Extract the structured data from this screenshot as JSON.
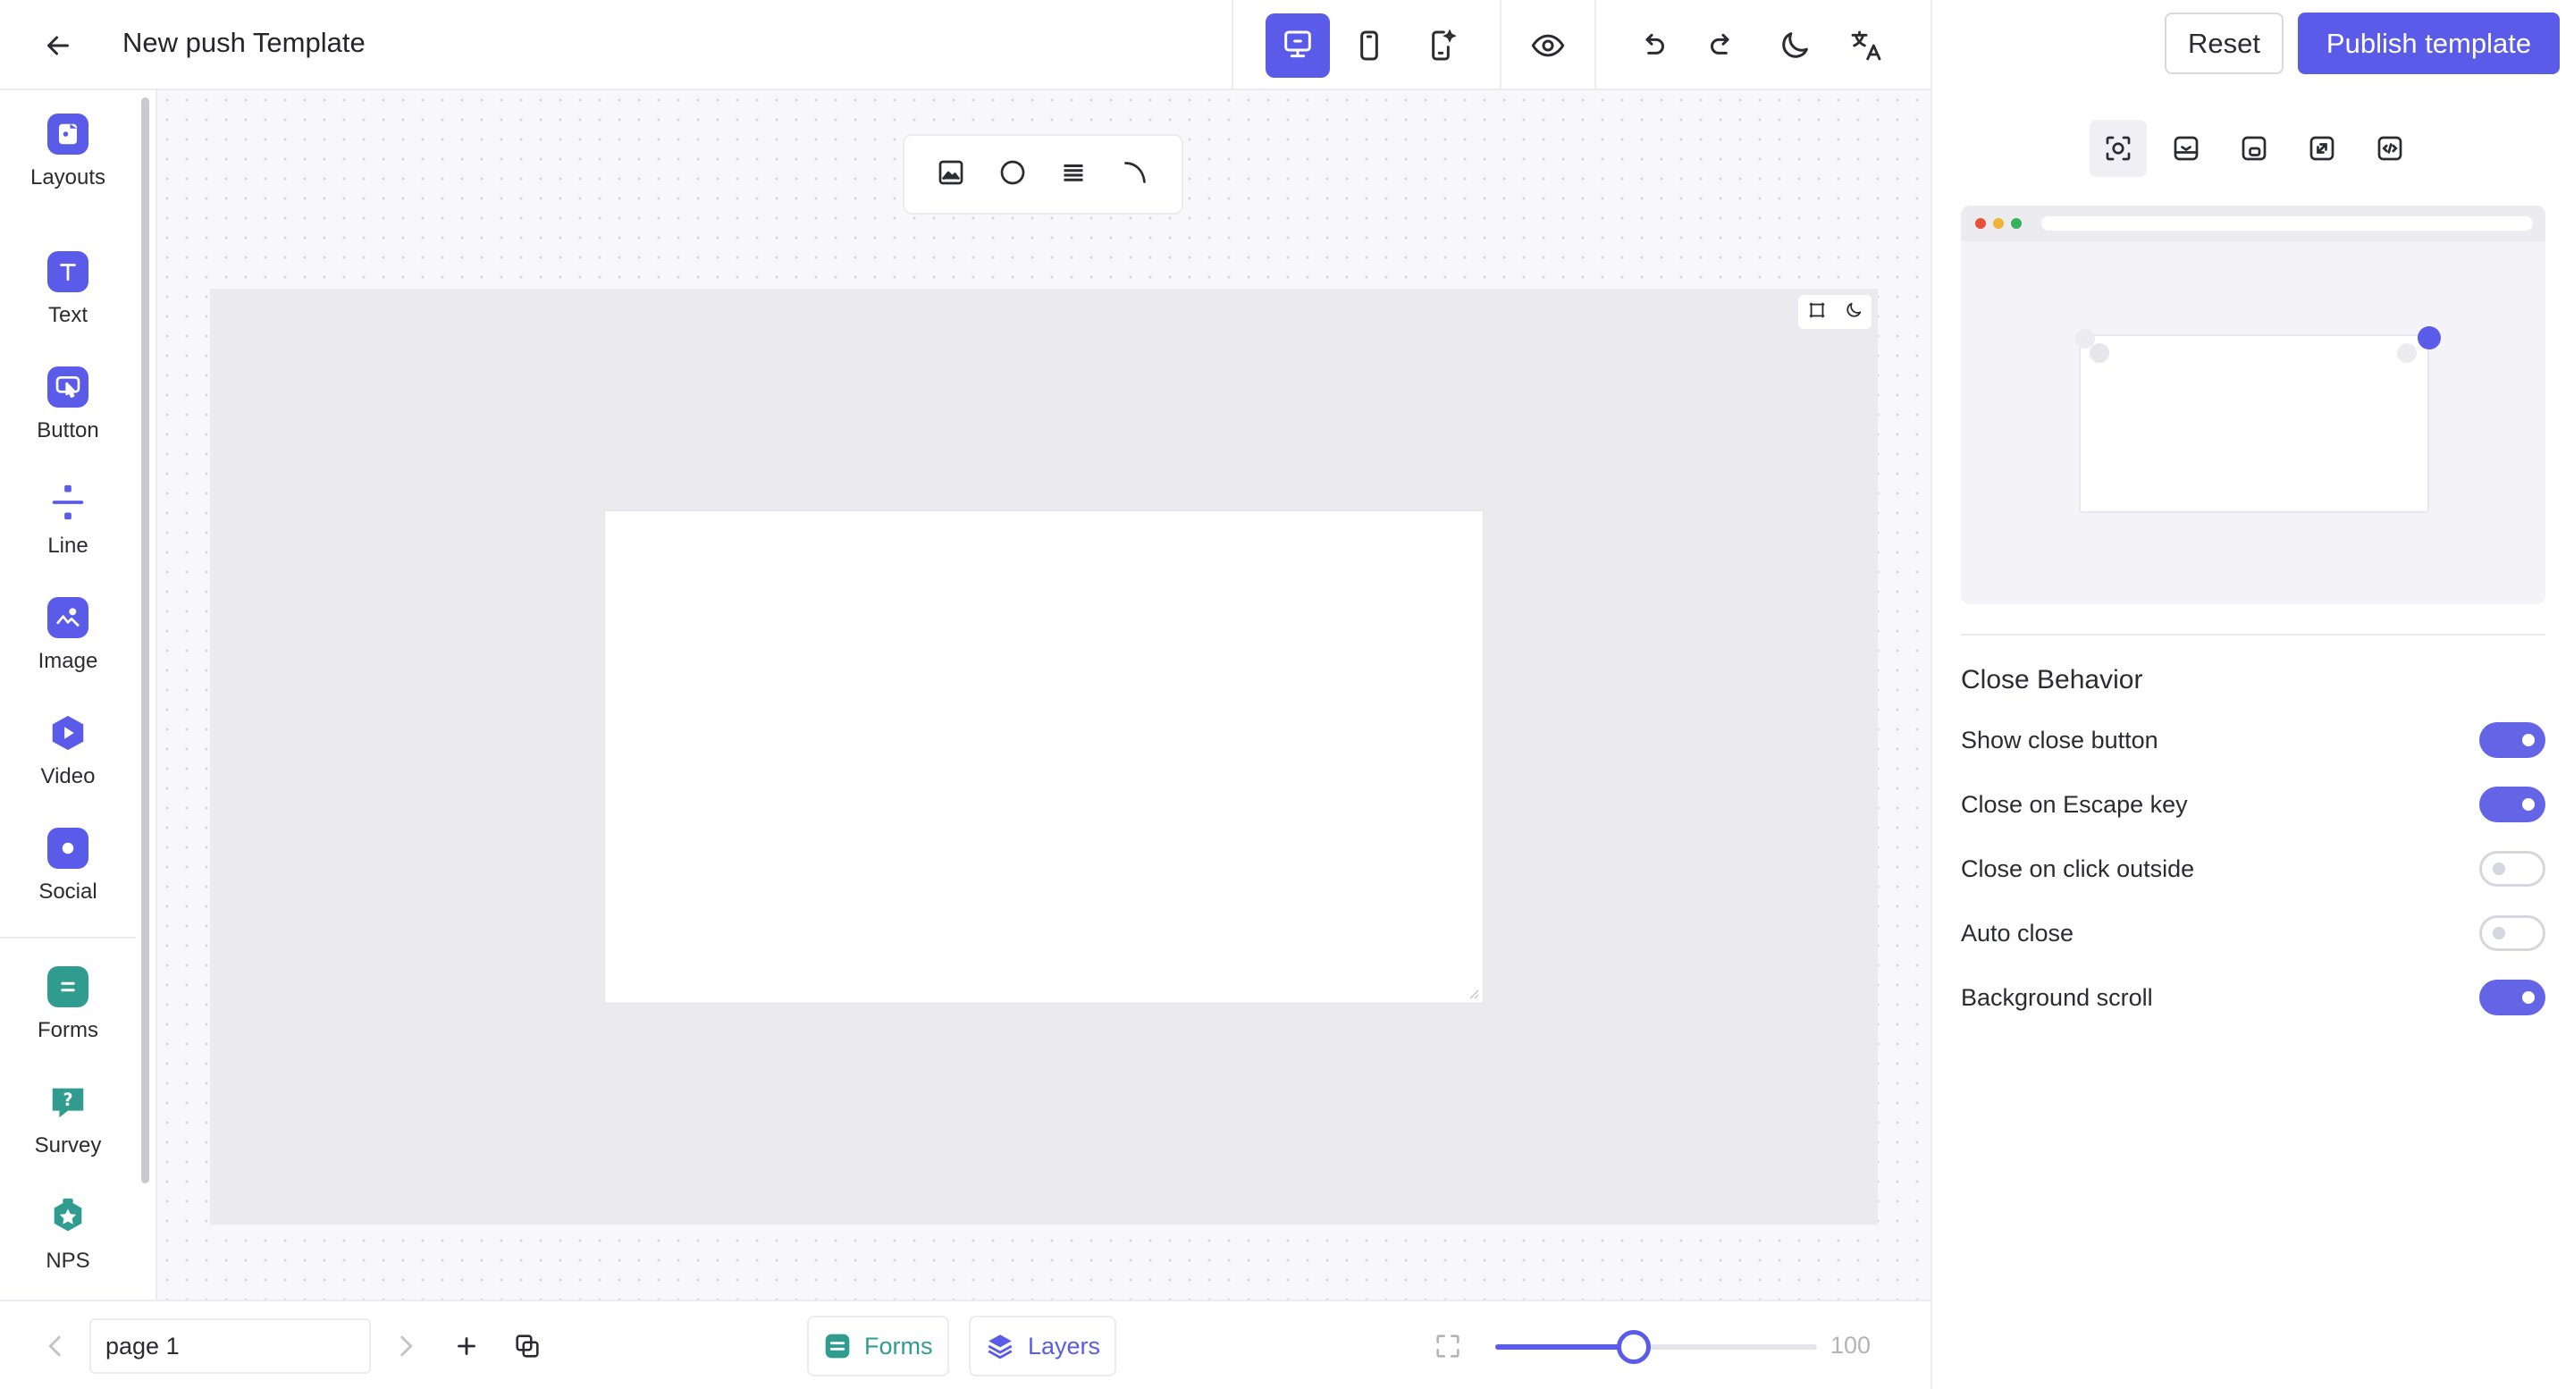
{
  "header": {
    "title": "New push Template",
    "reset_label": "Reset",
    "publish_label": "Publish template"
  },
  "sidebar": {
    "items": [
      {
        "label": "Layouts",
        "icon": "layouts-icon"
      },
      {
        "label": "Text",
        "icon": "text-icon"
      },
      {
        "label": "Button",
        "icon": "button-icon"
      },
      {
        "label": "Line",
        "icon": "line-icon"
      },
      {
        "label": "Image",
        "icon": "image-icon"
      },
      {
        "label": "Video",
        "icon": "video-icon"
      },
      {
        "label": "Social",
        "icon": "social-icon"
      },
      {
        "label": "Forms",
        "icon": "forms-icon"
      },
      {
        "label": "Survey",
        "icon": "survey-icon"
      },
      {
        "label": "NPS",
        "icon": "nps-icon"
      }
    ]
  },
  "bottombar": {
    "page_name": "page 1",
    "forms_label": "Forms",
    "layers_label": "Layers",
    "zoom_value": "100",
    "zoom_fraction": 0.43
  },
  "close_behavior": {
    "title": "Close Behavior",
    "options": [
      {
        "label": "Show close button",
        "on": true
      },
      {
        "label": "Close on Escape key",
        "on": true
      },
      {
        "label": "Close on click outside",
        "on": false
      },
      {
        "label": "Auto close",
        "on": false
      },
      {
        "label": "Background scroll",
        "on": true
      }
    ]
  },
  "colors": {
    "accent": "#5b5bea",
    "teal": "#2f9c8f",
    "canvas_stage": "#ebeaee"
  }
}
